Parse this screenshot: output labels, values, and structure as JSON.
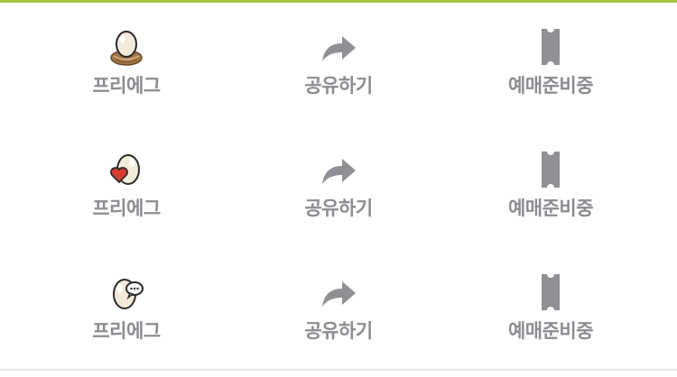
{
  "colors": {
    "accent_top_line": "#a3c63a",
    "label_gray": "#8a8c93",
    "icon_gray": "#8f9096",
    "divider": "#e6e6e6"
  },
  "rows": [
    {
      "egg_icon": "egg-nest-icon",
      "egg_label": "프리에그",
      "share_icon": "share-arrow-icon",
      "share_label": "공유하기",
      "ticket_icon": "ticket-icon",
      "ticket_label": "예매준비중"
    },
    {
      "egg_icon": "egg-heart-icon",
      "egg_label": "프리에그",
      "share_icon": "share-arrow-icon",
      "share_label": "공유하기",
      "ticket_icon": "ticket-icon",
      "ticket_label": "예매준비중"
    },
    {
      "egg_icon": "egg-speech-bubble-icon",
      "egg_label": "프리에그",
      "share_icon": "share-arrow-icon",
      "share_label": "공유하기",
      "ticket_icon": "ticket-icon",
      "ticket_label": "예매준비중"
    }
  ]
}
